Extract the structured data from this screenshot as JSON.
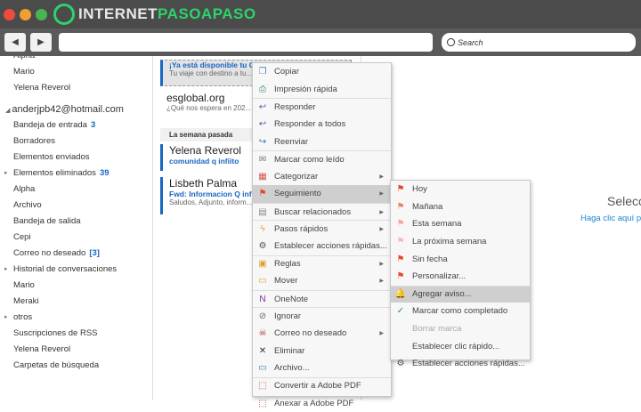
{
  "window": {
    "logo_text_a": "INTERNET",
    "logo_text_b": "PASOAPASO",
    "colors": {
      "close": "#ee4b3f",
      "min": "#f0a030",
      "max": "#49b552"
    }
  },
  "toolbar": {
    "back_icon": "◀",
    "forward_icon": "▶",
    "address_value": "",
    "search_placeholder": "Search"
  },
  "sidebar": {
    "items_top": [
      "Alpha",
      "Mario",
      "Yelena Reverol"
    ],
    "account": "anderjpb42@hotmail.com",
    "items": [
      {
        "label": "Bandeja de entrada",
        "count": "3"
      },
      {
        "label": "Borradores"
      },
      {
        "label": "Elementos enviados"
      },
      {
        "label": "Elementos eliminados",
        "count": "39",
        "expandable": true
      },
      {
        "label": "Alpha"
      },
      {
        "label": "Archivo"
      },
      {
        "label": "Bandeja de salida"
      },
      {
        "label": "Cepi"
      },
      {
        "label": "Correo no deseado",
        "count": "[3]"
      },
      {
        "label": "Historial de conversaciones",
        "expandable": true
      },
      {
        "label": "Mario"
      },
      {
        "label": "Meraki"
      },
      {
        "label": "otros",
        "expandable": true
      },
      {
        "label": "Suscripciones de RSS"
      },
      {
        "label": "Yelena Reverol"
      },
      {
        "label": "Carpetas de búsqueda"
      }
    ]
  },
  "messages": [
    {
      "subject": "¡Ya está disponible tu C...",
      "preview": "Tu viaje con destino a tu..."
    },
    {
      "from": "esglobal.org",
      "preview": "¿Qué nos espera en 202..."
    }
  ],
  "group_label": "La semana pasada",
  "messages2": [
    {
      "from": "Yelena Reverol",
      "subject": "comunidad q infiito"
    },
    {
      "from": "Lisbeth Palma",
      "subject": "Fwd: Informacion Q inf...",
      "preview": "Saludos,  Adjunto, inform..."
    }
  ],
  "reading": {
    "title": "Selecci",
    "link": "Haga clic aquí pa"
  },
  "context_menu": [
    {
      "label": "Copiar",
      "icon": "copy-icon"
    },
    {
      "label": "Impresión rápida",
      "icon": "print-icon"
    },
    {
      "label": "Responder",
      "icon": "reply-icon",
      "sep": true
    },
    {
      "label": "Responder a todos",
      "icon": "reply-all-icon"
    },
    {
      "label": "Reenviar",
      "icon": "forward-icon"
    },
    {
      "label": "Marcar como leído",
      "icon": "envelope-open-icon",
      "sep": true
    },
    {
      "label": "Categorizar",
      "icon": "categorize-icon",
      "sub": true
    },
    {
      "label": "Seguimiento",
      "icon": "flag-icon",
      "sub": true,
      "selected": true
    },
    {
      "label": "Buscar relacionados",
      "icon": "document-icon",
      "sub": true,
      "sep": true
    },
    {
      "label": "Pasos rápidos",
      "icon": "lightning-icon",
      "sub": true,
      "sep": true
    },
    {
      "label": "Establecer acciones rápidas...",
      "icon": "gears-icon"
    },
    {
      "label": "Reglas",
      "icon": "rules-icon",
      "sub": true,
      "sep": true
    },
    {
      "label": "Mover",
      "icon": "move-icon",
      "sub": true
    },
    {
      "label": "OneNote",
      "icon": "onenote-icon",
      "sep": true
    },
    {
      "label": "Ignorar",
      "icon": "ignore-icon",
      "sep": true
    },
    {
      "label": "Correo no deseado",
      "icon": "junk-icon",
      "sub": true
    },
    {
      "label": "Eliminar",
      "icon": "delete-icon"
    },
    {
      "label": "Archivo...",
      "icon": "archive-icon"
    },
    {
      "label": "Convertir a Adobe PDF",
      "icon": "pdf-icon",
      "sep": true
    },
    {
      "label": "Anexar a Adobe PDF",
      "icon": "pdf-icon"
    }
  ],
  "submenu": [
    {
      "label": "Hoy",
      "icon": "flag-icon",
      "color": "#e8462a"
    },
    {
      "label": "Mañana",
      "icon": "flag-icon",
      "color": "#f07c66"
    },
    {
      "label": "Esta semana",
      "icon": "flag-icon",
      "color": "#f5a395"
    },
    {
      "label": "La próxima semana",
      "icon": "flag-icon",
      "color": "#f7b8ad"
    },
    {
      "label": "Sin fecha",
      "icon": "flag-icon",
      "color": "#e8462a"
    },
    {
      "label": "Personalizar...",
      "icon": "flag-icon",
      "color": "#e8462a"
    },
    {
      "label": "Agregar aviso...",
      "icon": "bell-icon",
      "color": "#f3b64a",
      "selected": true,
      "sep": true
    },
    {
      "label": "Marcar como completado",
      "icon": "check-icon",
      "color": "#1e9a6a"
    },
    {
      "label": "Borrar marca",
      "disabled": true
    },
    {
      "label": "Establecer clic rápido..."
    },
    {
      "label": "Establecer acciones rápidas...",
      "icon": "gears-icon",
      "color": "#555"
    }
  ]
}
